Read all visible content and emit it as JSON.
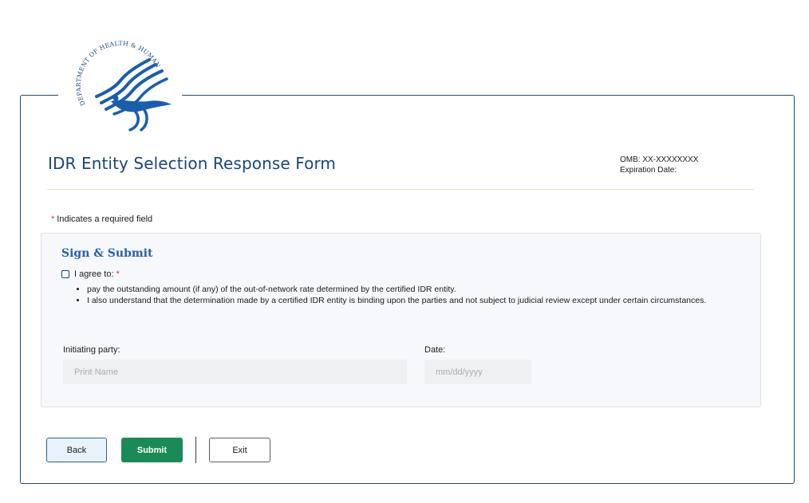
{
  "logo": {
    "ring_text": "DEPARTMENT OF HEALTH & HUMAN SERVICES · USA"
  },
  "header": {
    "title": "IDR Entity Selection Response Form",
    "omb": "OMB: XX-XXXXXXXX",
    "expiration": "Expiration Date:"
  },
  "required_note": {
    "asterisk": "*",
    "text": "Indicates a required field"
  },
  "section": {
    "title": "Sign & Submit",
    "agree_label": "I agree to:",
    "agree_asterisk": "*",
    "agree_checked": false,
    "bullets": [
      "pay the outstanding amount (if any) of the out-of-network rate determined by the certified IDR entity.",
      "I also understand that the determination made by a certified IDR entity is binding upon the parties and not subject to judicial review except under certain circumstances."
    ],
    "initiating_party_label": "Initiating party:",
    "initiating_party_placeholder": "Print Name",
    "initiating_party_value": "",
    "date_label": "Date:",
    "date_placeholder": "mm/dd/yyyy",
    "date_value": ""
  },
  "buttons": {
    "back": "Back",
    "submit": "Submit",
    "exit": "Exit"
  },
  "colors": {
    "primary_blue": "#1a4480",
    "submit_green": "#1b8a57",
    "required_red": "#d83933",
    "card_border": "#1c4f73"
  }
}
